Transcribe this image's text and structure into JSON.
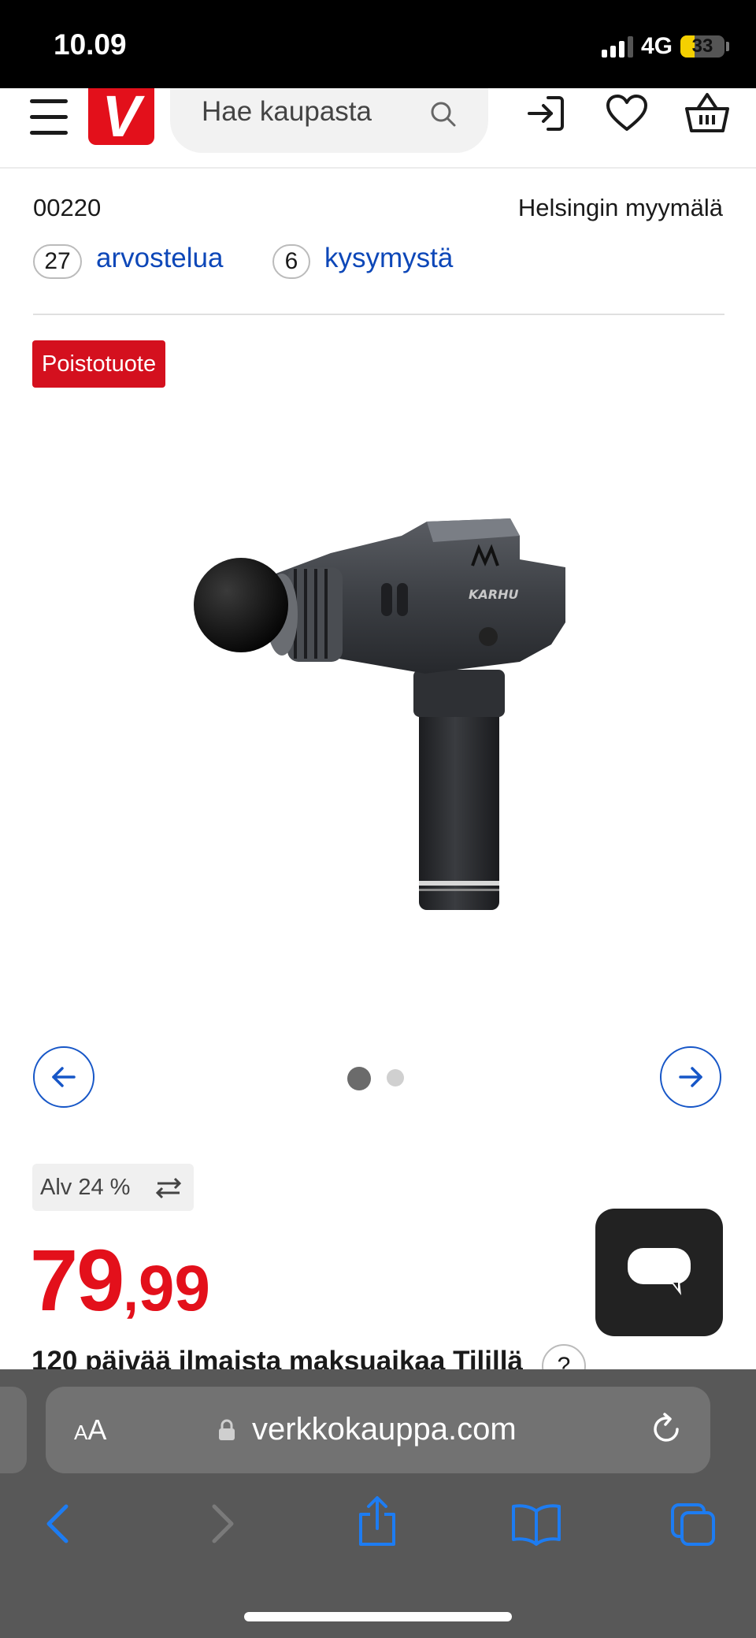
{
  "status_bar": {
    "time": "10.09",
    "network": "4G",
    "battery": "33"
  },
  "header": {
    "logo_letter": "V",
    "search_placeholder": "Hae kaupasta"
  },
  "store_info": {
    "postal_code": "00220",
    "store_name": "Helsingin myymälä",
    "reviews_count": "27",
    "reviews_label": "arvostelua",
    "questions_count": "6",
    "questions_label": "kysymystä"
  },
  "product": {
    "tag": "Poistotuote",
    "brand_mark": "KARHU",
    "image_name": "massage gun product photo",
    "carousel": {
      "total_images": 2,
      "active_index": 0
    }
  },
  "pricing": {
    "vat_label": "Alv 24 %",
    "price_whole": "79",
    "price_separator": ",",
    "price_decimals": "99",
    "financing_text": "120 päivää ilmaista maksuaikaa Tilillä",
    "help_label": "?"
  },
  "browser": {
    "text_size_label_small": "A",
    "text_size_label_large": "A",
    "url": "verkkokauppa.com"
  },
  "colors": {
    "brand_red": "#e3101b",
    "link_blue": "#0d47b8",
    "safari_blue": "#1d7cf2"
  }
}
